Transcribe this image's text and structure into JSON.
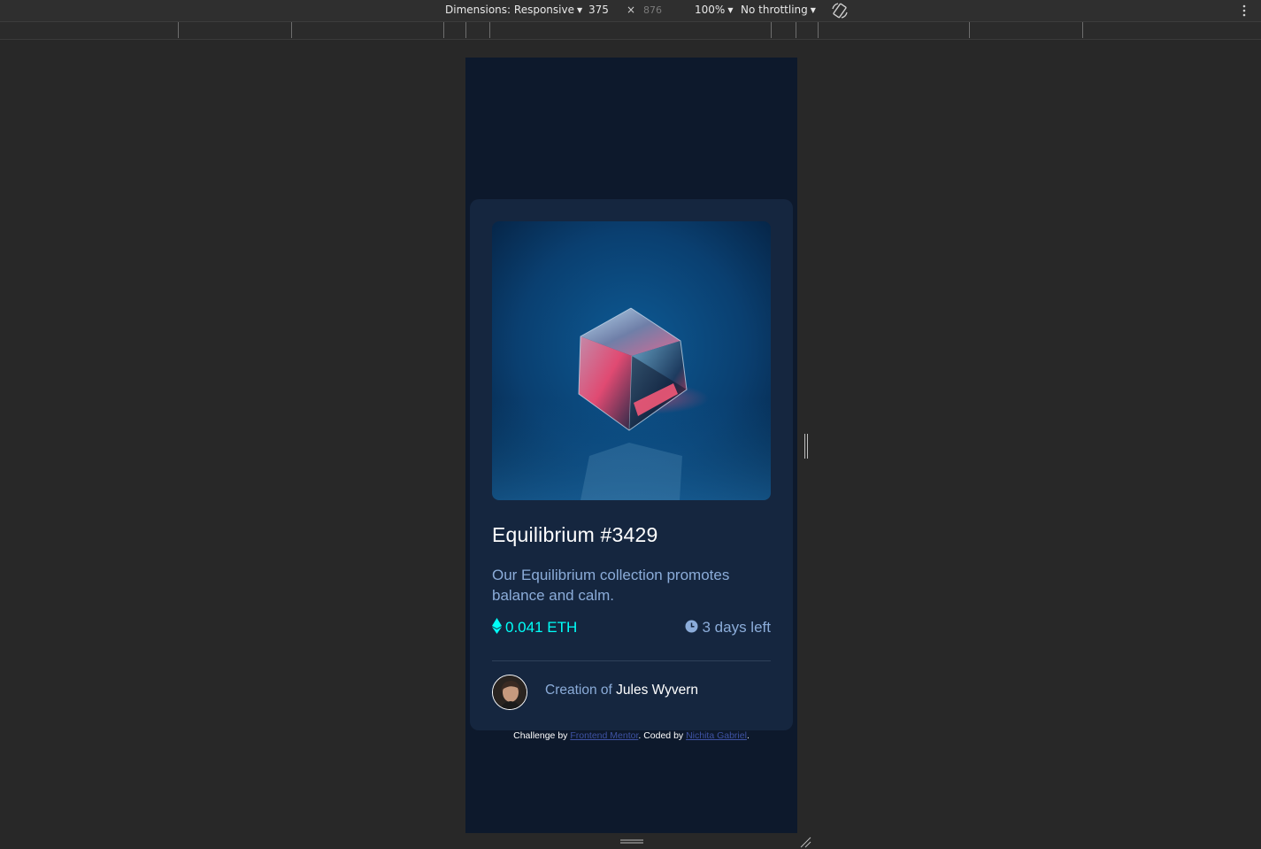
{
  "devtools": {
    "dimensions_label": "Dimensions: Responsive",
    "width": "375",
    "times": "×",
    "height": "876",
    "zoom": "100%",
    "throttling": "No throttling"
  },
  "card": {
    "title": "Equilibrium #3429",
    "description": "Our Equilibrium collection promotes balance and calm.",
    "price": "0.041 ETH",
    "time_left": "3 days left",
    "creator_prefix": "Creation of ",
    "creator_name": "Jules Wyvern",
    "icons": {
      "price": "ethereum-icon",
      "time": "clock-icon",
      "avatar": "avatar-image"
    }
  },
  "attribution": {
    "prefix": "Challenge by ",
    "link1": "Frontend Mentor",
    "middle": ". Coded by ",
    "link2": "Nichita Gabriel",
    "suffix": "."
  },
  "colors": {
    "page_bg": "#0d192c",
    "card_bg": "#15263f",
    "cyan": "#00fff8",
    "soft_blue": "#8bacd9",
    "white": "#ffffff"
  }
}
